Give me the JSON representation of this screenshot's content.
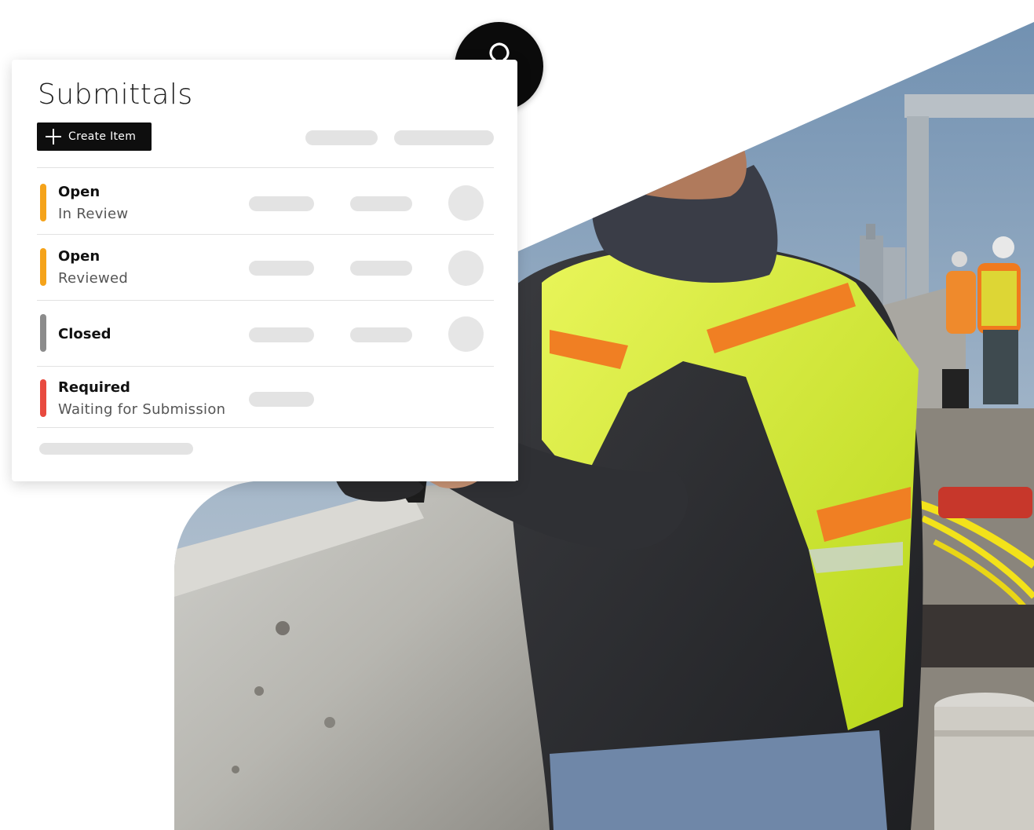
{
  "card": {
    "title": "Submittals",
    "create_button": "Create Item"
  },
  "rows": [
    {
      "status": "Open",
      "substatus": "In Review",
      "color": "#f5a31a"
    },
    {
      "status": "Open",
      "substatus": "Reviewed",
      "color": "#f5a31a"
    },
    {
      "status": "Closed",
      "substatus": "",
      "color": "#8c8c8c"
    },
    {
      "status": "Required",
      "substatus": "Waiting for Submission",
      "color": "#e84a3f"
    }
  ],
  "icons": {
    "stamp": "stamp-icon",
    "plus": "plus-icon"
  },
  "photo": {
    "subject": "construction-worker-with-tablet"
  }
}
